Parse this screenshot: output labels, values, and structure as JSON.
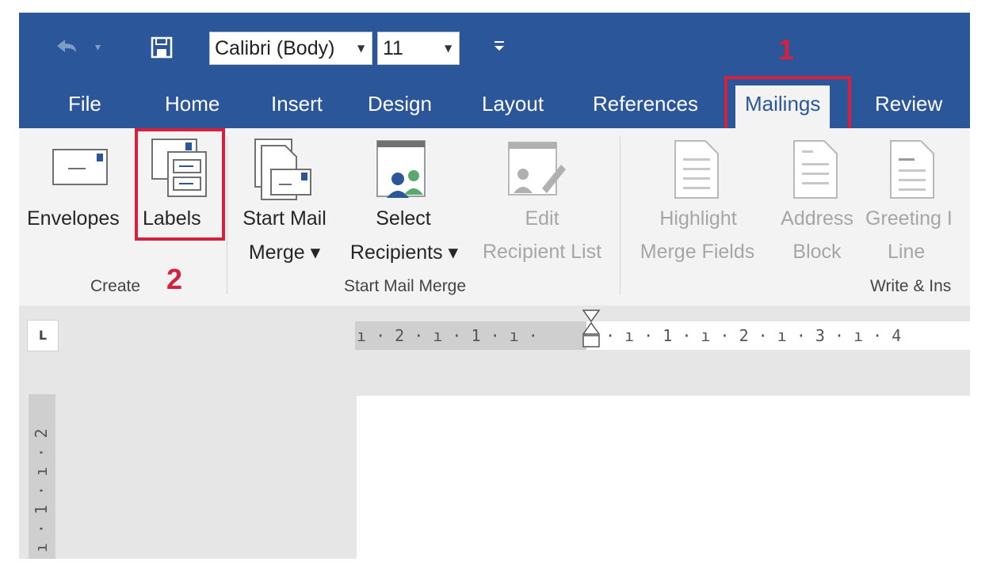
{
  "qat": {
    "undo_icon": "undo-icon",
    "save_icon": "save-icon",
    "font_name": "Calibri (Body)",
    "font_size": "11",
    "customize_icon": "customize-qat-icon"
  },
  "tabs": [
    {
      "label": "File"
    },
    {
      "label": "Home"
    },
    {
      "label": "Insert"
    },
    {
      "label": "Design"
    },
    {
      "label": "Layout"
    },
    {
      "label": "References"
    },
    {
      "label": "Mailings",
      "active": true
    },
    {
      "label": "Review"
    }
  ],
  "ribbon": {
    "create": {
      "group_label": "Create",
      "envelopes": "Envelopes",
      "labels": "Labels"
    },
    "start_mail_merge": {
      "group_label": "Start Mail Merge",
      "start_line1": "Start Mail",
      "start_line2": "Merge ▾",
      "select_line1": "Select",
      "select_line2": "Recipients ▾",
      "edit_line1": "Edit",
      "edit_line2": "Recipient List"
    },
    "write_insert": {
      "group_label": "Write & Ins",
      "highlight_line1": "Highlight",
      "highlight_line2": "Merge Fields",
      "address_line1": "Address",
      "address_line2": "Block",
      "greeting_line1": "Greeting I",
      "greeting_line2": "Line"
    }
  },
  "annotations": {
    "step1": "1",
    "step2": "2",
    "color": "#d4213d"
  },
  "ruler": {
    "tab_selector": "L",
    "left_text": "ı · 2 · ı · 1 · ı ·",
    "right_text": "· ı · 1 · ı · 2 · ı · 3 · ı · 4",
    "vertical_text": "ı · 1 · ı · 2"
  },
  "colors": {
    "title_bar": "#2b579a",
    "ribbon_bg": "#f3f3f3",
    "workspace": "#e6e6e6"
  }
}
